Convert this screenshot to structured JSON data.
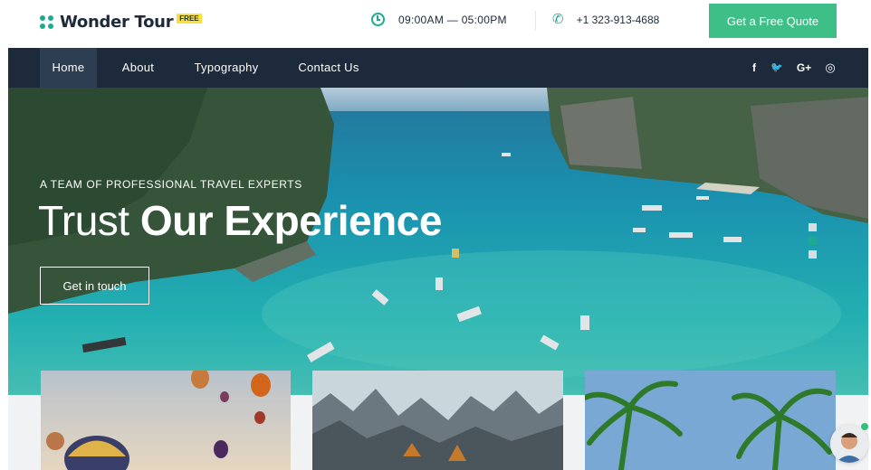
{
  "brand": {
    "name": "Wonder Tour",
    "badge": "FREE"
  },
  "topbar": {
    "hours": "09:00AM — 05:00PM",
    "phone": "+1 323-913-4688",
    "quote_button": "Get a Free Quote"
  },
  "nav": {
    "items": [
      {
        "label": "Home",
        "active": true
      },
      {
        "label": "About"
      },
      {
        "label": "Typography"
      },
      {
        "label": "Contact Us"
      }
    ],
    "social": [
      {
        "icon": "facebook-icon",
        "glyph": "f"
      },
      {
        "icon": "twitter-icon",
        "glyph": "🐦"
      },
      {
        "icon": "google-plus-icon",
        "glyph": "G+"
      },
      {
        "icon": "instagram-icon",
        "glyph": "◎"
      }
    ]
  },
  "hero": {
    "eyebrow": "A TEAM OF PROFESSIONAL TRAVEL EXPERTS",
    "headline_light": "Trust",
    "headline_bold": "Our Experience",
    "cta": "Get in touch",
    "slides": 3,
    "active_slide": 2
  },
  "colors": {
    "accent": "#3fbf88",
    "nav_bg": "#1c2a3c",
    "brand_teal": "#1bab8f",
    "badge_yellow": "#f7e23a"
  }
}
